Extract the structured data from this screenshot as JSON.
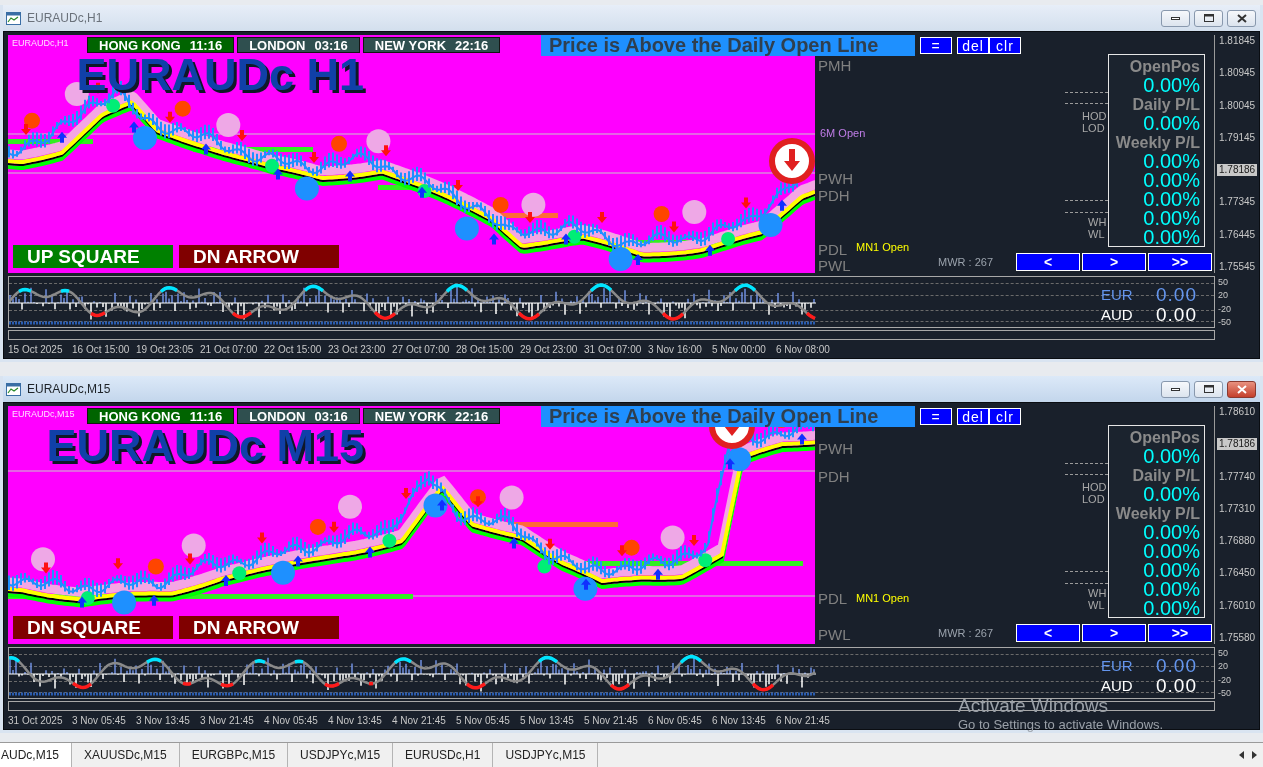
{
  "windows": [
    {
      "title": "EURAUDc,H1",
      "active": false,
      "symbol_label": "EURAUDc,H1",
      "sessions": [
        {
          "city": "HONG KONG",
          "time": "11:16",
          "open": true
        },
        {
          "city": "LONDON",
          "time": "03:16",
          "open": false
        },
        {
          "city": "NEW YORK",
          "time": "22:16",
          "open": false
        }
      ],
      "chart_title": "EURAUDc H1",
      "status_banner": "Price is Above the Daily Open Line",
      "tool_buttons": [
        "=",
        "del",
        "clr"
      ],
      "signal_buttons": [
        {
          "label": "UP SQUARE",
          "kind": "up"
        },
        {
          "label": "DN ARROW",
          "kind": "down"
        }
      ],
      "level_labels": [
        {
          "text": "PMH",
          "kind": "level",
          "color": "#808080"
        },
        {
          "text": "6M Open",
          "kind": "open",
          "color": "#c07de8"
        },
        {
          "text": "PWH",
          "kind": "level",
          "color": "#808080"
        },
        {
          "text": "PDH",
          "kind": "level",
          "color": "#808080"
        },
        {
          "text": "PDL",
          "kind": "level",
          "color": "#808080"
        },
        {
          "text": "MN1 Open",
          "kind": "open",
          "color": "#ffff00"
        },
        {
          "text": "PWL",
          "kind": "level",
          "color": "#808080"
        }
      ],
      "range_labels": [
        "HOD",
        "LOD",
        "WH",
        "WL"
      ],
      "mwr": "MWR : 267",
      "pl_panel": [
        {
          "label": "OpenPos",
          "values": [
            "0.00%"
          ]
        },
        {
          "label": "Daily P/L",
          "values": [
            "0.00%"
          ]
        },
        {
          "label": "Weekly P/L",
          "values": [
            "0.00%",
            "0.00%",
            "0.00%",
            "0.00%",
            "0.00%"
          ]
        }
      ],
      "nav_buttons": [
        "<",
        ">",
        ">>"
      ],
      "price_scale": [
        {
          "value": "1.81845",
          "current": false
        },
        {
          "value": "1.80945",
          "current": false
        },
        {
          "value": "1.80045",
          "current": false
        },
        {
          "value": "1.79145",
          "current": false
        },
        {
          "value": "1.78186",
          "current": true
        },
        {
          "value": "1.77345",
          "current": false
        },
        {
          "value": "1.76445",
          "current": false
        },
        {
          "value": "1.75545",
          "current": false
        }
      ],
      "oscillator": {
        "scale": [
          "50",
          "20",
          "-20",
          "-50"
        ],
        "currencies": [
          {
            "code": "EUR",
            "value": "0.00",
            "kind": "base"
          },
          {
            "code": "AUD",
            "value": "0.00",
            "kind": "quote"
          }
        ]
      },
      "time_axis": [
        "15 Oct 2025",
        "16 Oct 15:00",
        "19 Oct 23:05",
        "21 Oct 07:00",
        "22 Oct 15:00",
        "23 Oct 23:00",
        "27 Oct 07:00",
        "28 Oct 15:00",
        "29 Oct 23:00",
        "31 Oct 07:00",
        "3 Nov 16:00",
        "5 Nov 00:00",
        "6 Nov 08:00"
      ]
    },
    {
      "title": "EURAUDc,M15",
      "active": true,
      "symbol_label": "EURAUDc,M15",
      "sessions": [
        {
          "city": "HONG KONG",
          "time": "11:16",
          "open": true
        },
        {
          "city": "LONDON",
          "time": "03:16",
          "open": false
        },
        {
          "city": "NEW YORK",
          "time": "22:16",
          "open": false
        }
      ],
      "chart_title": "EURAUDc M15",
      "status_banner": "Price is Above the Daily Open Line",
      "tool_buttons": [
        "=",
        "del",
        "clr"
      ],
      "signal_buttons": [
        {
          "label": "DN SQUARE",
          "kind": "down"
        },
        {
          "label": "DN ARROW",
          "kind": "down"
        }
      ],
      "level_labels": [
        {
          "text": "PWH",
          "kind": "level",
          "color": "#808080"
        },
        {
          "text": "PDH",
          "kind": "level",
          "color": "#808080"
        },
        {
          "text": "PDL",
          "kind": "level",
          "color": "#808080"
        },
        {
          "text": "MN1 Open",
          "kind": "open",
          "color": "#ffff00"
        },
        {
          "text": "PWL",
          "kind": "level",
          "color": "#808080"
        }
      ],
      "range_labels": [
        "HOD",
        "LOD",
        "WH",
        "WL"
      ],
      "mwr": "MWR : 267",
      "pl_panel": [
        {
          "label": "OpenPos",
          "values": [
            "0.00%"
          ]
        },
        {
          "label": "Daily P/L",
          "values": [
            "0.00%"
          ]
        },
        {
          "label": "Weekly P/L",
          "values": [
            "0.00%",
            "0.00%",
            "0.00%",
            "0.00%",
            "0.00%"
          ]
        }
      ],
      "nav_buttons": [
        "<",
        ">",
        ">>"
      ],
      "price_scale": [
        {
          "value": "1.78610",
          "current": false
        },
        {
          "value": "1.78186",
          "current": true
        },
        {
          "value": "1.77740",
          "current": false
        },
        {
          "value": "1.77310",
          "current": false
        },
        {
          "value": "1.76880",
          "current": false
        },
        {
          "value": "1.76450",
          "current": false
        },
        {
          "value": "1.76010",
          "current": false
        },
        {
          "value": "1.75580",
          "current": false
        }
      ],
      "oscillator": {
        "scale": [
          "50",
          "20",
          "-20",
          "-50"
        ],
        "currencies": [
          {
            "code": "EUR",
            "value": "0.00",
            "kind": "base"
          },
          {
            "code": "AUD",
            "value": "0.00",
            "kind": "quote"
          }
        ]
      },
      "time_axis": [
        "31 Oct 2025",
        "3 Nov 05:45",
        "3 Nov 13:45",
        "3 Nov 21:45",
        "4 Nov 05:45",
        "4 Nov 13:45",
        "4 Nov 21:45",
        "5 Nov 05:45",
        "5 Nov 13:45",
        "5 Nov 21:45",
        "6 Nov 05:45",
        "6 Nov 13:45",
        "6 Nov 21:45"
      ]
    }
  ],
  "tabs": [
    {
      "label": "AUDc,M15",
      "selected": true
    },
    {
      "label": "XAUUSDc,M15",
      "selected": false
    },
    {
      "label": "EURGBPc,M15",
      "selected": false
    },
    {
      "label": "USDJPYc,M15",
      "selected": false
    },
    {
      "label": "EURUSDc,H1",
      "selected": false
    },
    {
      "label": "USDJPYc,M15",
      "selected": false
    }
  ],
  "os_notice": {
    "title": "Activate Windows",
    "text": "Go to Settings to activate Windows."
  }
}
